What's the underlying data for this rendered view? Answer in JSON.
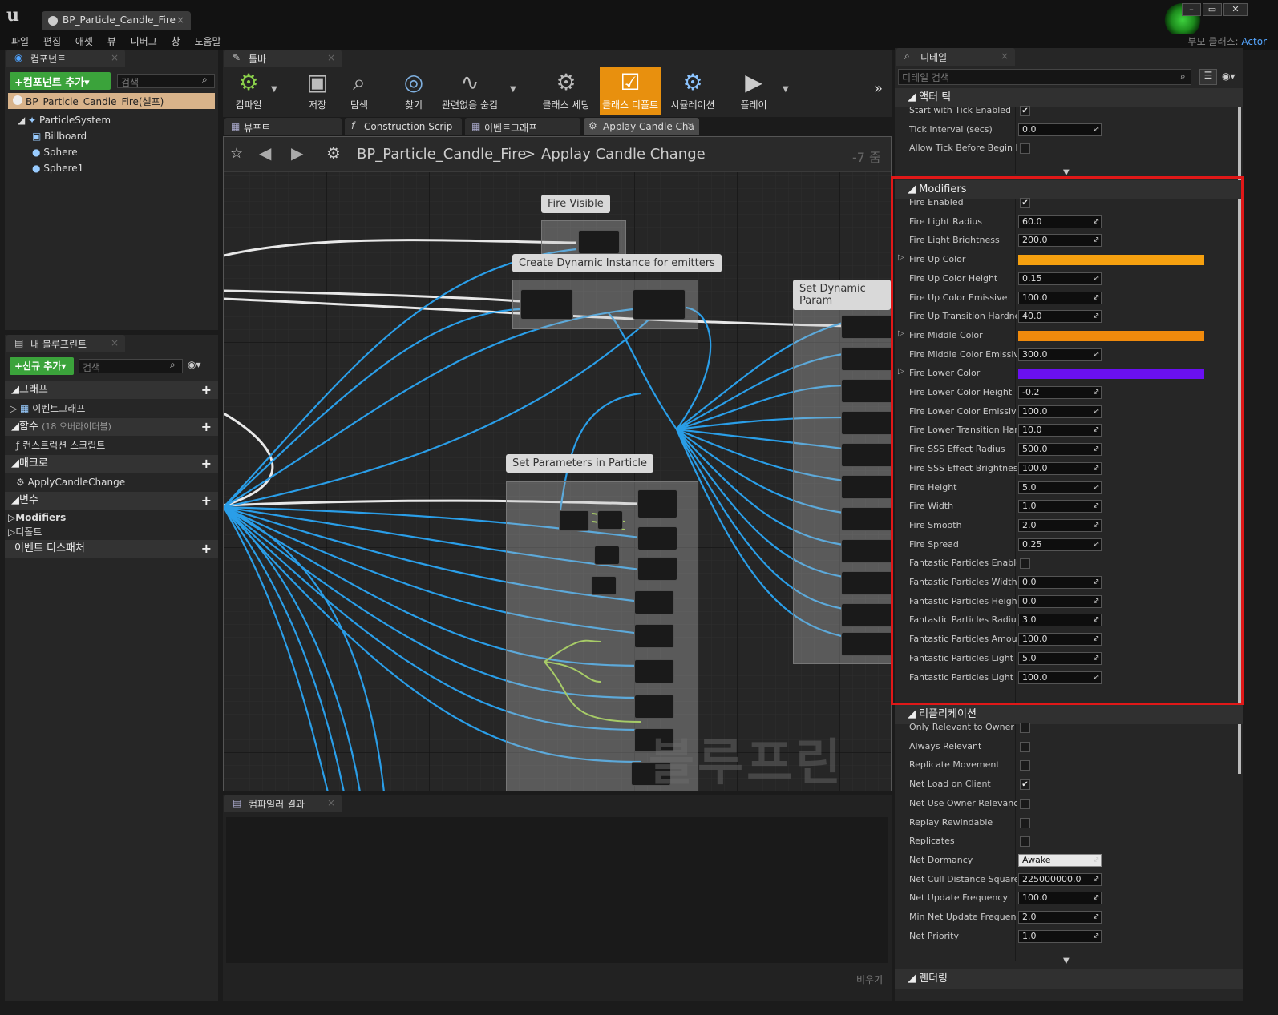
{
  "window": {
    "tab_title": "BP_Particle_Candle_Fire",
    "parent_class_label": "부모 클래스:",
    "parent_class_value": "Actor",
    "minimize": "–",
    "maximize": "▭",
    "close": "✕"
  },
  "menu": [
    "파일",
    "편집",
    "애셋",
    "뷰",
    "디버그",
    "창",
    "도움말"
  ],
  "components": {
    "tab": "컴포넌트",
    "add_button": "+컴포넌트 추가▾",
    "search_placeholder": "검색",
    "root": "BP_Particle_Candle_Fire(셀프)",
    "items": [
      "ParticleSystem",
      "Billboard",
      "Sphere",
      "Sphere1"
    ]
  },
  "my_blueprint": {
    "tab": "내 블루프린트",
    "add_button": "+신규 추가▾",
    "search_placeholder": "검색",
    "sections": {
      "graph": "그래프",
      "graph_item": "이벤트그래프",
      "functions": "함수",
      "functions_note": "(18 오버라이더블)",
      "function_item": "컨스트럭션 스크립트",
      "macros": "매크로",
      "macro_item": "ApplyCandleChange",
      "variables": "변수",
      "var_cat1": "Modifiers",
      "var_cat2": "디폴트",
      "dispatchers": "이벤트 디스패처"
    }
  },
  "toolbar": {
    "tab": "툴바",
    "buttons": [
      "컴파일",
      "저장",
      "탐색",
      "찾기",
      "관련없음 숨김",
      "클래스 세팅",
      "클래스 디폴트",
      "시뮬레이션",
      "플레이"
    ]
  },
  "graph_tabs": [
    "뷰포트",
    "Construction Scrip",
    "이벤트그래프",
    "Applay Candle Cha"
  ],
  "graph": {
    "breadcrumb_root": "BP_Particle_Candle_Fire",
    "breadcrumb_sep": ">",
    "breadcrumb_leaf": "Applay Candle Change",
    "zoom": "-7 줌",
    "watermark": "블루프린트",
    "comments": [
      "Fire Visible",
      "Create Dynamic Instance for emitters",
      "Set Dynamic Param",
      "Set Parameters in Particle"
    ]
  },
  "compiler": {
    "tab": "컴파일러 결과",
    "clear": "비우기"
  },
  "details": {
    "tab": "디테일",
    "search_placeholder": "디테일 검색",
    "actor_tick": {
      "header": "액터 틱",
      "rows": [
        {
          "label": "Start with Tick Enabled",
          "type": "check",
          "value": "✔"
        },
        {
          "label": "Tick Interval (secs)",
          "type": "num",
          "value": "0.0"
        },
        {
          "label": "Allow Tick Before Begin Pla",
          "type": "check",
          "value": ""
        }
      ]
    },
    "modifiers": {
      "header": "Modifiers",
      "rows": [
        {
          "label": "Fire Enabled",
          "type": "check",
          "value": "✔"
        },
        {
          "label": "Fire Light Radius",
          "type": "num",
          "value": "60.0"
        },
        {
          "label": "Fire Light Brightness",
          "type": "num",
          "value": "200.0"
        },
        {
          "label": "Fire Up Color",
          "type": "color",
          "value": "#f5a00f"
        },
        {
          "label": "Fire Up Color Height",
          "type": "num",
          "value": "0.15"
        },
        {
          "label": "Fire Up Color Emissive",
          "type": "num",
          "value": "100.0"
        },
        {
          "label": "Fire Up Transition Hardnes",
          "type": "num",
          "value": "40.0"
        },
        {
          "label": "Fire Middle Color",
          "type": "color",
          "value": "#f08a0c"
        },
        {
          "label": "Fire Middle Color Emissive",
          "type": "num",
          "value": "300.0"
        },
        {
          "label": "Fire Lower Color",
          "type": "color",
          "value": "#6a10f0"
        },
        {
          "label": "Fire Lower Color Height",
          "type": "num",
          "value": "-0.2"
        },
        {
          "label": "Fire Lower Color Emissive",
          "type": "num",
          "value": "100.0"
        },
        {
          "label": "Fire Lower Transition Hardi",
          "type": "num",
          "value": "10.0"
        },
        {
          "label": "Fire SSS Effect Radius",
          "type": "num",
          "value": "500.0"
        },
        {
          "label": "Fire SSS Effect Brightness",
          "type": "num",
          "value": "100.0"
        },
        {
          "label": "Fire Height",
          "type": "num",
          "value": "5.0"
        },
        {
          "label": "Fire Width",
          "type": "num",
          "value": "1.0"
        },
        {
          "label": "Fire Smooth",
          "type": "num",
          "value": "2.0"
        },
        {
          "label": "Fire Spread",
          "type": "num",
          "value": "0.25"
        },
        {
          "label": "Fantastic Particles Enablec",
          "type": "check",
          "value": ""
        },
        {
          "label": "Fantastic Particles Width",
          "type": "num",
          "value": "0.0"
        },
        {
          "label": "Fantastic Particles Height",
          "type": "num",
          "value": "0.0"
        },
        {
          "label": "Fantastic Particles Radius",
          "type": "num",
          "value": "3.0"
        },
        {
          "label": "Fantastic Particles Amount",
          "type": "num",
          "value": "100.0"
        },
        {
          "label": "Fantastic Particles Light Ra",
          "type": "num",
          "value": "5.0"
        },
        {
          "label": "Fantastic Particles Light Br",
          "type": "num",
          "value": "100.0"
        }
      ]
    },
    "replication": {
      "header": "리플리케이션",
      "rows": [
        {
          "label": "Only Relevant to Owner",
          "type": "check",
          "value": ""
        },
        {
          "label": "Always Relevant",
          "type": "check",
          "value": ""
        },
        {
          "label": "Replicate Movement",
          "type": "check",
          "value": ""
        },
        {
          "label": "Net Load on Client",
          "type": "check",
          "value": "✔"
        },
        {
          "label": "Net Use Owner Relevancy",
          "type": "check",
          "value": ""
        },
        {
          "label": "Replay Rewindable",
          "type": "check",
          "value": ""
        },
        {
          "label": "Replicates",
          "type": "check",
          "value": ""
        },
        {
          "label": "Net Dormancy",
          "type": "select",
          "value": "Awake"
        },
        {
          "label": "Net Cull Distance Squared",
          "type": "num",
          "value": "225000000.0"
        },
        {
          "label": "Net Update Frequency",
          "type": "num",
          "value": "100.0"
        },
        {
          "label": "Min Net Update Frequency",
          "type": "num",
          "value": "2.0"
        },
        {
          "label": "Net Priority",
          "type": "num",
          "value": "1.0"
        }
      ]
    },
    "rendering": {
      "header": "렌더링"
    }
  }
}
